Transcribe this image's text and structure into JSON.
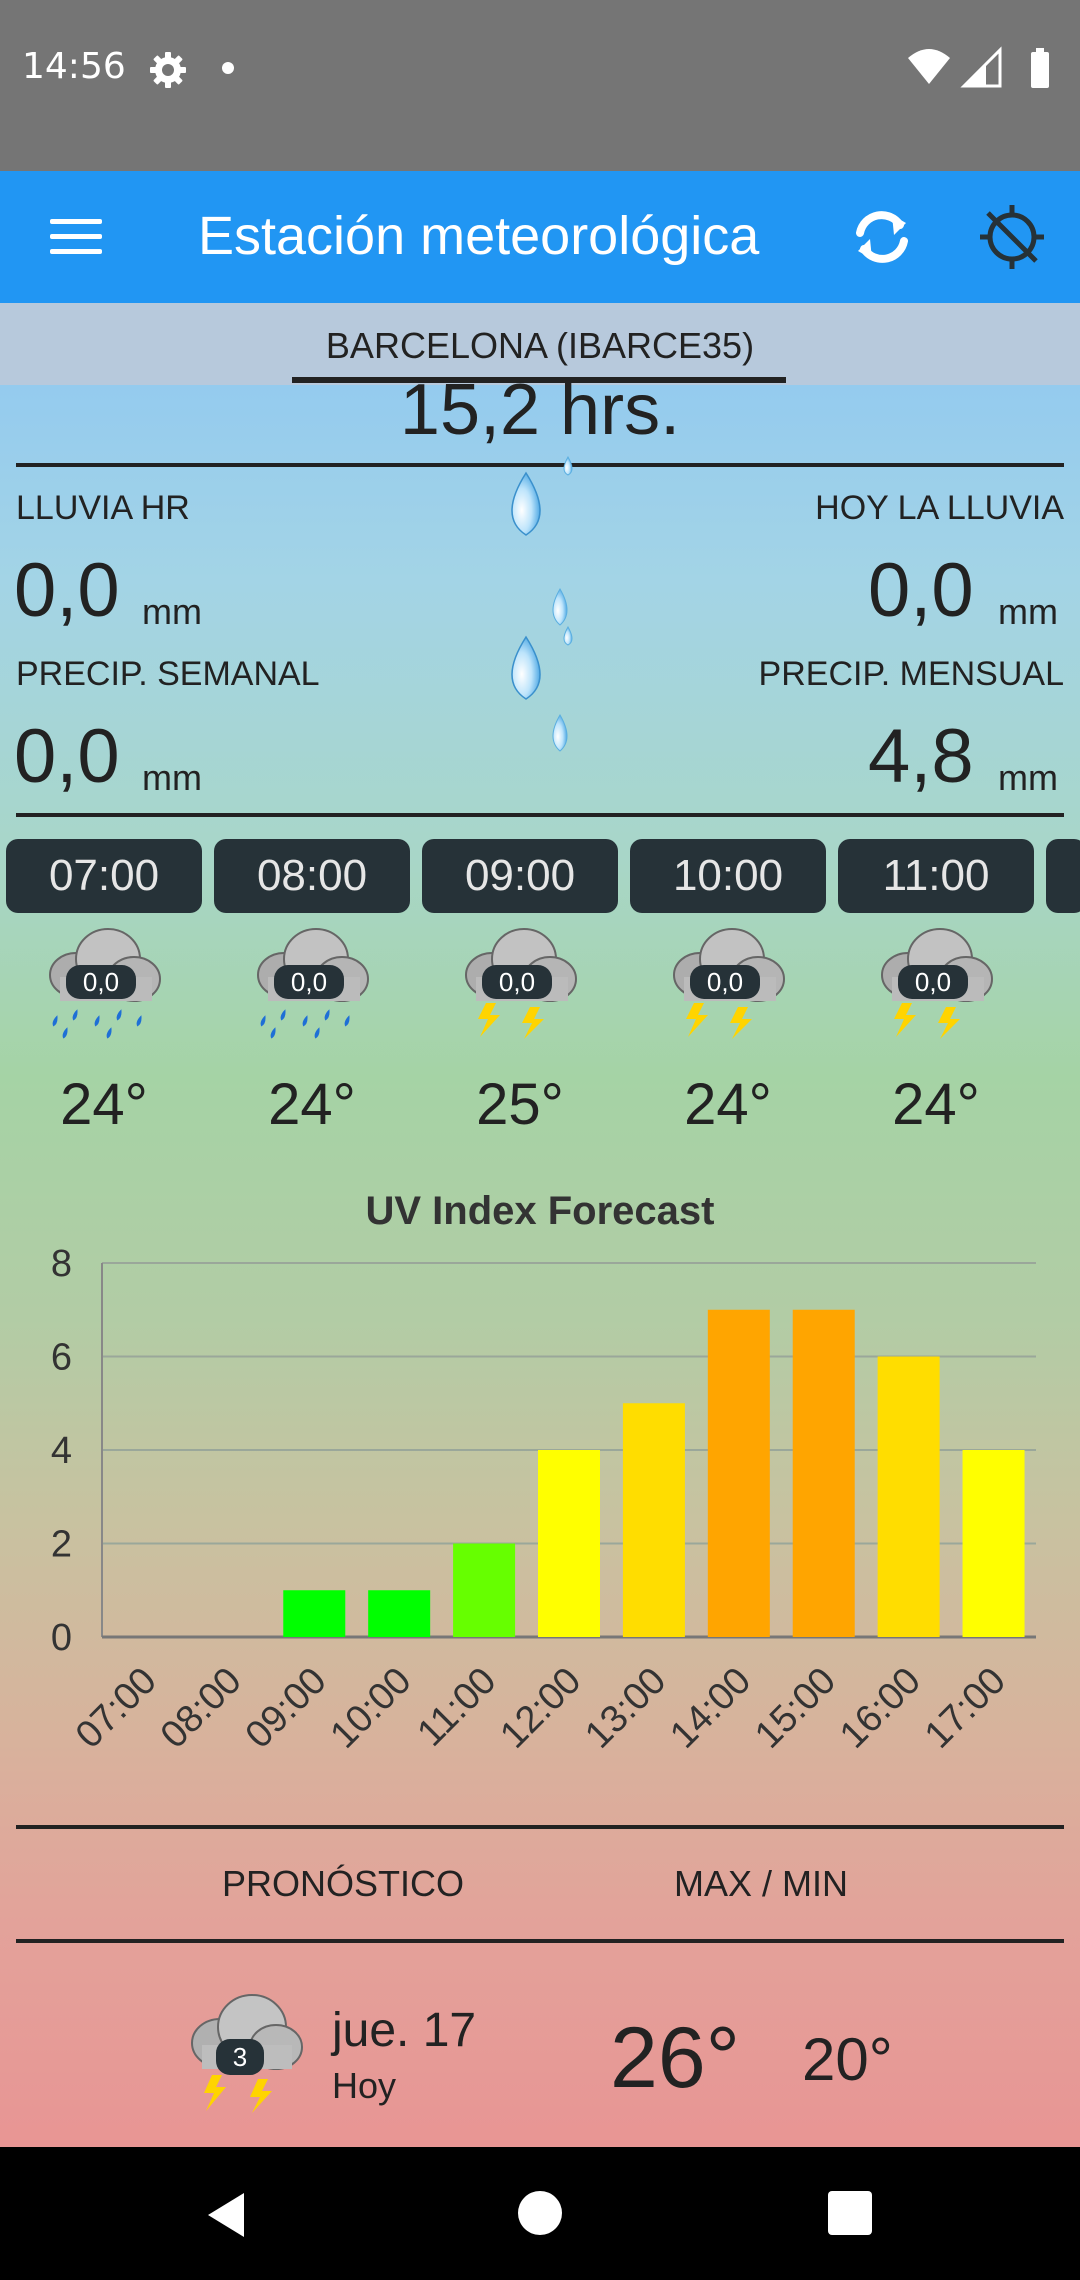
{
  "status_bar": {
    "time": "14:56"
  },
  "app_bar": {
    "title": "Estación meteorológica"
  },
  "station": {
    "name": "BARCELONA (IBARCE35)"
  },
  "sun_hours": "15,2 hrs.",
  "rain": {
    "hourly": {
      "label": "LLUVIA HR",
      "value": "0,0",
      "unit": "mm"
    },
    "today": {
      "label": "HOY LA LLUVIA",
      "value": "0,0",
      "unit": "mm"
    },
    "weekly": {
      "label": "PRECIP. SEMANAL",
      "value": "0,0",
      "unit": "mm"
    },
    "monthly": {
      "label": "PRECIP. MENSUAL",
      "value": "4,8",
      "unit": "mm"
    }
  },
  "hourly_forecast": [
    {
      "time": "07:00",
      "icon": "cloud-rain-icon",
      "rain": "0,0",
      "temp": "24°"
    },
    {
      "time": "08:00",
      "icon": "cloud-rain-icon",
      "rain": "0,0",
      "temp": "24°"
    },
    {
      "time": "09:00",
      "icon": "cloud-storm-icon",
      "rain": "0,0",
      "temp": "25°"
    },
    {
      "time": "10:00",
      "icon": "cloud-storm-icon",
      "rain": "0,0",
      "temp": "24°"
    },
    {
      "time": "11:00",
      "icon": "cloud-storm-icon",
      "rain": "0,0",
      "temp": "24°"
    }
  ],
  "chart_data": {
    "type": "bar",
    "title": "UV Index Forecast",
    "categories": [
      "07:00",
      "08:00",
      "09:00",
      "10:00",
      "11:00",
      "12:00",
      "13:00",
      "14:00",
      "15:00",
      "16:00",
      "17:00"
    ],
    "values": [
      0,
      0,
      1,
      1,
      2,
      4,
      5,
      7,
      7,
      6,
      4
    ],
    "colors": [
      "#00ff00",
      "#00ff00",
      "#00ff00",
      "#00ff00",
      "#66ff00",
      "#ffff00",
      "#ffdd00",
      "#ffa500",
      "#ffa500",
      "#ffdd00",
      "#ffff00"
    ],
    "ylim": [
      0,
      8
    ],
    "yticks": [
      0,
      2,
      4,
      6,
      8
    ],
    "xlabel": "",
    "ylabel": "",
    "grid": true,
    "legend": "none"
  },
  "forecast_header": {
    "forecast_label": "PRONÓSTICO",
    "maxmin_label": "MAX / MIN"
  },
  "daily_forecast": [
    {
      "day": "jue. 17",
      "sub": "Hoy",
      "icon": "cloud-storm-icon",
      "badge": "3",
      "max": "26°",
      "min": "20°"
    }
  ]
}
